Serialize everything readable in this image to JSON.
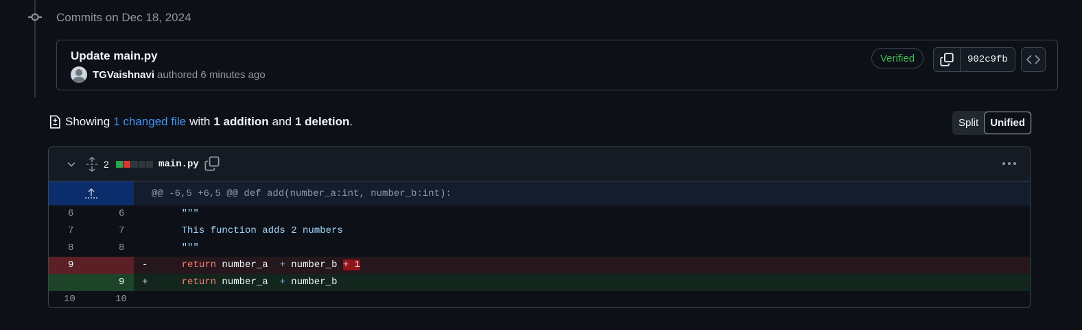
{
  "timeline": {
    "heading": "Commits on Dec 18, 2024"
  },
  "commit": {
    "title": "Update main.py",
    "author": "TGVaishnavi",
    "meta": "authored 6 minutes ago",
    "badge": "Verified",
    "sha": "902c9fb"
  },
  "summary": {
    "showing": "Showing",
    "changed_link": "1 changed file",
    "with": "with",
    "additions": "1 addition",
    "and": "and",
    "deletions": "1 deletion",
    "period": "."
  },
  "view_toggle": {
    "split": "Split",
    "unified": "Unified"
  },
  "file": {
    "changes": "2",
    "name": "main.py",
    "diffstat": [
      "add",
      "del",
      "neutral",
      "neutral",
      "neutral"
    ],
    "hunk_header": "@@ -6,5 +6,5 @@ def add(number_a:int, number_b:int):",
    "lines": [
      {
        "type": "context",
        "old": "6",
        "new": "6",
        "mark": "",
        "code": "    \"\"\""
      },
      {
        "type": "context",
        "old": "7",
        "new": "7",
        "mark": "",
        "code": "    This function adds 2 numbers"
      },
      {
        "type": "context",
        "old": "8",
        "new": "8",
        "mark": "",
        "code": "    \"\"\""
      },
      {
        "type": "del",
        "old": "9",
        "new": "",
        "mark": "-",
        "kw": "return",
        "code": " number_a  ",
        "op1": "+",
        "code2": " number_b ",
        "hl": "+ 1"
      },
      {
        "type": "add",
        "old": "",
        "new": "9",
        "mark": "+",
        "kw": "return",
        "code": " number_a  ",
        "op1": "+",
        "code2": " number_b"
      },
      {
        "type": "context",
        "old": "10",
        "new": "10",
        "mark": "",
        "code": ""
      }
    ]
  },
  "colors": {
    "background": "#0d1117",
    "verified": "#3fb950",
    "link": "#4493f8",
    "addition": "#2da44e",
    "deletion": "#da3633"
  },
  "icons": [
    "commit-node-icon",
    "avatar-icon",
    "copy-icon",
    "code-icon",
    "file-diff-icon",
    "chevron-down-icon",
    "expand-icon",
    "kebab-icon",
    "expand-up-icon"
  ]
}
